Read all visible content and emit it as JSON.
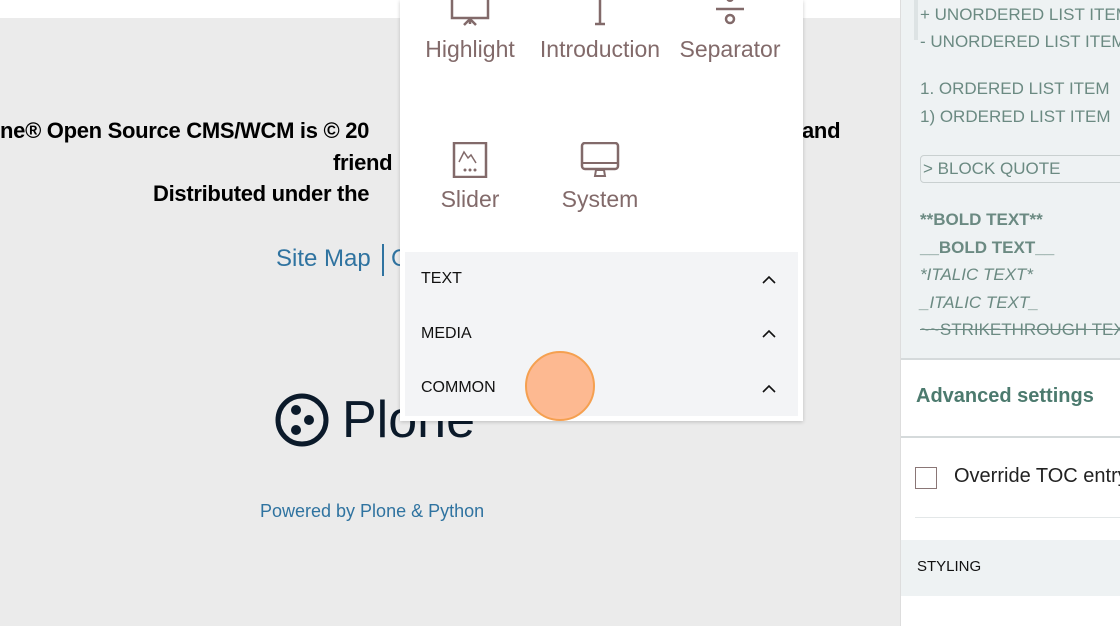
{
  "footer": {
    "line1_left": "ne® Open Source CMS/WCM is © 20",
    "line1_right": "and",
    "line2": "friend",
    "line3": "Distributed under the",
    "site_map": "Site Map",
    "next_link_fragment": "C",
    "logo_text": "Plone",
    "powered_by": "Powered by Plone & Python"
  },
  "block_chooser": {
    "blocks": [
      {
        "label": "Highlight",
        "icon": "highlight-icon"
      },
      {
        "label": "Introduction",
        "icon": "text-icon"
      },
      {
        "label": "Separator",
        "icon": "separator-icon"
      },
      {
        "label": "Slider",
        "icon": "slider-icon"
      },
      {
        "label": "System",
        "icon": "monitor-icon"
      }
    ],
    "categories": [
      "TEXT",
      "MEDIA",
      "COMMON"
    ]
  },
  "sidebar": {
    "markdown_help": [
      "+ UNORDERED LIST ITEM",
      "- UNORDERED LIST ITEM",
      "1. ORDERED LIST ITEM",
      "1) ORDERED LIST ITEM",
      "> BLOCK QUOTE",
      "**BOLD TEXT**",
      "__BOLD TEXT__",
      "*ITALIC TEXT*",
      "_ITALIC TEXT_",
      "~~STRIKETHROUGH TEXT~~"
    ],
    "advanced_settings": "Advanced settings",
    "override_toc": "Override TOC entry",
    "override_toc_checked": false,
    "styling": "STYLING"
  },
  "colors": {
    "accent": "#4c7a6e",
    "link": "#2f73a0",
    "icon": "#826a6a",
    "cursor": "#ffaa78"
  }
}
